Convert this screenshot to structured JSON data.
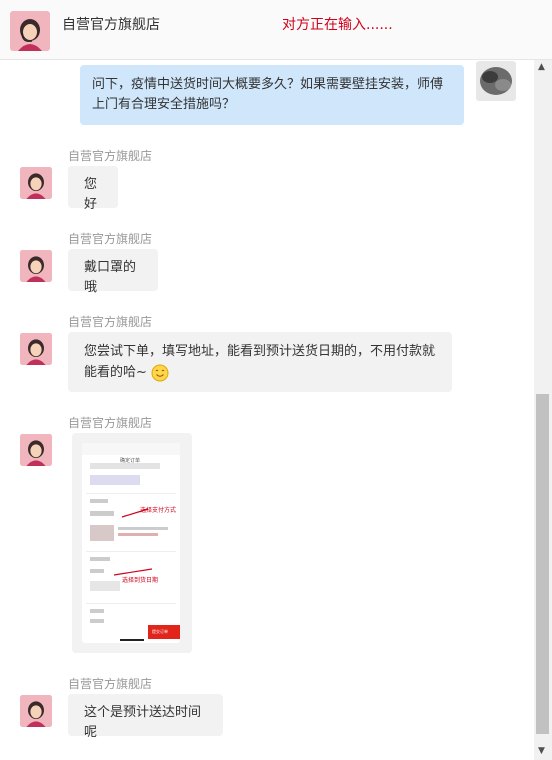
{
  "header": {
    "shop_name": "自营官方旗舰店",
    "typing_status": "对方正在输入......"
  },
  "messages": [
    {
      "sender": "me",
      "text": "问下，疫情中送货时间大概要多久？如果需要壁挂安装，师傅上门有合理安全措施吗？"
    },
    {
      "sender": "shop",
      "name": "自营官方旗舰店",
      "text": "您好"
    },
    {
      "sender": "shop",
      "name": "自营官方旗舰店",
      "text": "戴口罩的哦"
    },
    {
      "sender": "shop",
      "name": "自营官方旗舰店",
      "text": "您尝试下单，填写地址，能看到预计送货日期的，不用付款就能看的哈~",
      "emoji": "smile-emoji"
    },
    {
      "sender": "shop",
      "name": "自营官方旗舰店",
      "type": "image",
      "image_texts": [
        "确定订单",
        "选择支付方式",
        "选择到货日期",
        "提交订单"
      ]
    },
    {
      "sender": "shop",
      "name": "自营官方旗舰店",
      "text": "这个是预计送达时间呢"
    }
  ],
  "colors": {
    "my_bubble": "#cfe6fb",
    "shop_bubble": "#f2f2f2",
    "typing_status": "#d0021b",
    "name_text": "#999999"
  }
}
